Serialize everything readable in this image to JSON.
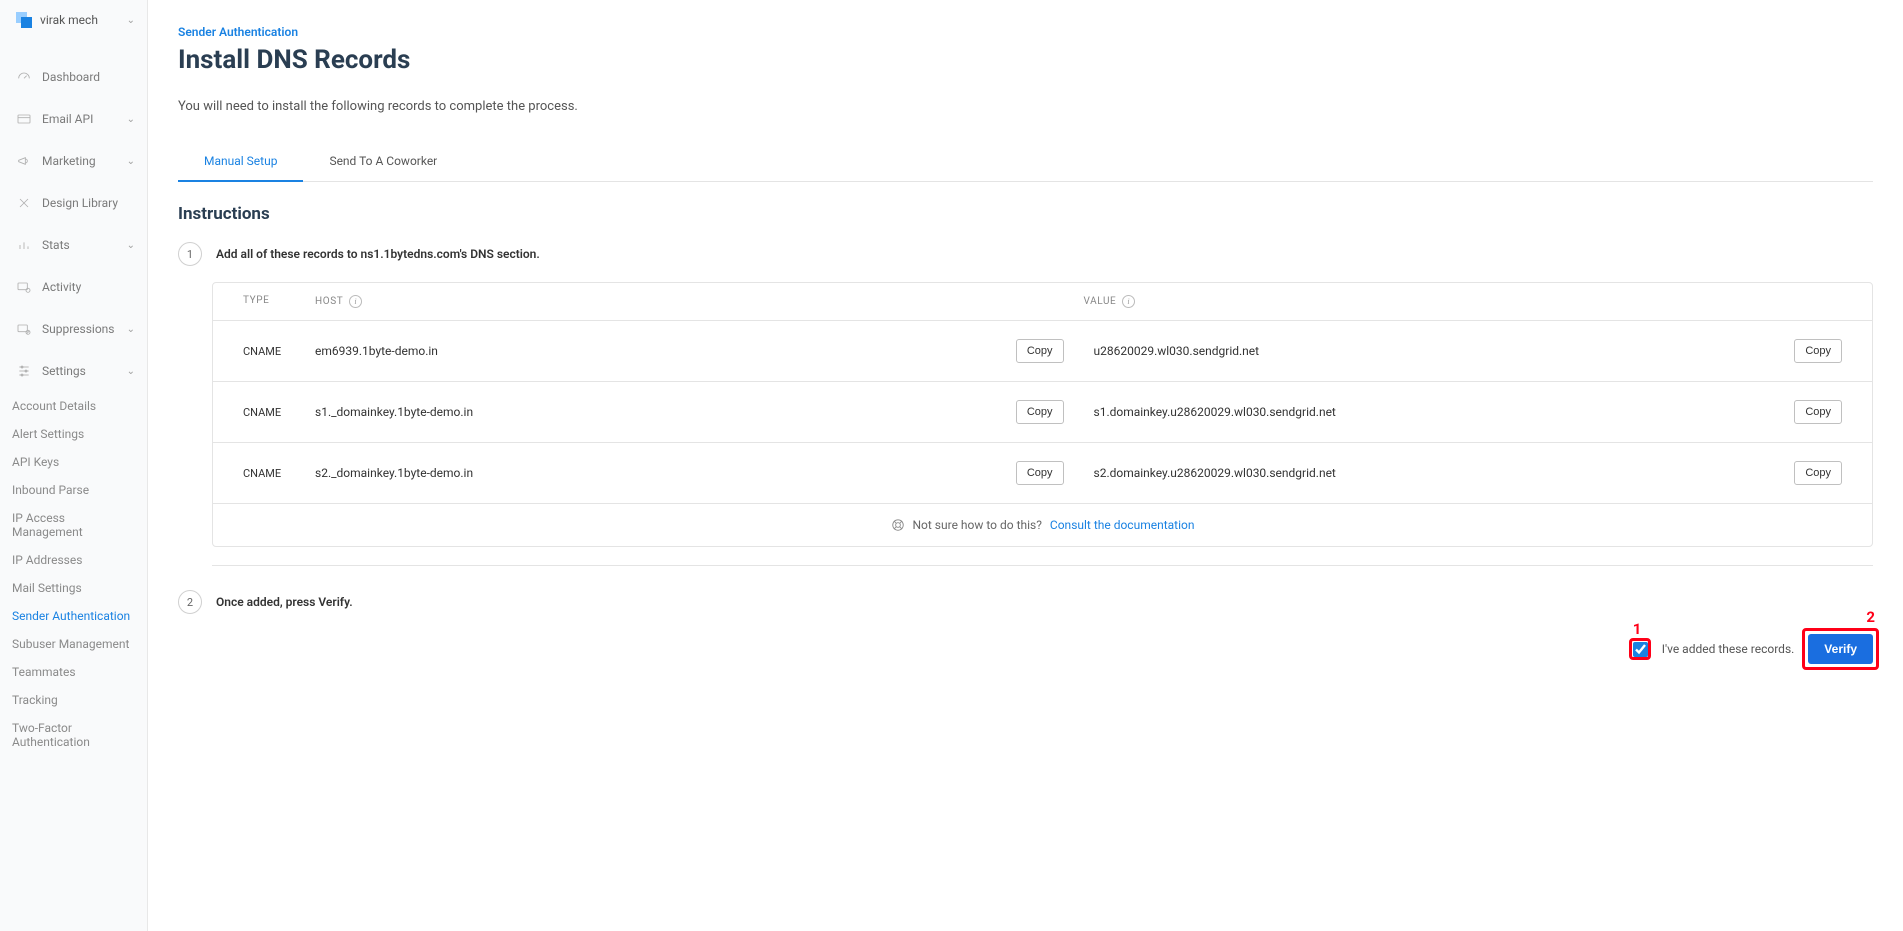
{
  "account": {
    "name": "virak mech"
  },
  "nav": {
    "dashboard": "Dashboard",
    "email_api": "Email API",
    "marketing": "Marketing",
    "design_library": "Design Library",
    "stats": "Stats",
    "activity": "Activity",
    "suppressions": "Suppressions",
    "settings": "Settings",
    "sub": {
      "account_details": "Account Details",
      "alert_settings": "Alert Settings",
      "api_keys": "API Keys",
      "inbound_parse": "Inbound Parse",
      "ip_access": "IP Access Management",
      "ip_addresses": "IP Addresses",
      "mail_settings": "Mail Settings",
      "sender_auth": "Sender Authentication",
      "subuser": "Subuser Management",
      "teammates": "Teammates",
      "tracking": "Tracking",
      "two_factor": "Two-Factor Authentication"
    }
  },
  "header": {
    "breadcrumb": "Sender Authentication",
    "title": "Install DNS Records",
    "description": "You will need to install the following records to complete the process."
  },
  "tabs": {
    "manual": "Manual Setup",
    "coworker": "Send To A Coworker"
  },
  "section": {
    "instructions": "Instructions"
  },
  "steps": {
    "one": "Add all of these records to ns1.1bytedns.com's DNS section.",
    "two": "Once added, press Verify."
  },
  "table": {
    "th_type": "TYPE",
    "th_host": "HOST",
    "th_value": "VALUE",
    "copy": "Copy",
    "rows": [
      {
        "type": "CNAME",
        "host": "em6939.1byte-demo.in",
        "value": "u28620029.wl030.sendgrid.net"
      },
      {
        "type": "CNAME",
        "host": "s1._domainkey.1byte-demo.in",
        "value": "s1.domainkey.u28620029.wl030.sendgrid.net"
      },
      {
        "type": "CNAME",
        "host": "s2._domainkey.1byte-demo.in",
        "value": "s2.domainkey.u28620029.wl030.sendgrid.net"
      }
    ],
    "footer_prefix": "Not sure how to do this?",
    "footer_link": "Consult the documentation"
  },
  "verify": {
    "checkbox_label": "I've added these records.",
    "button": "Verify"
  },
  "annot": {
    "one": "1",
    "two": "2"
  }
}
